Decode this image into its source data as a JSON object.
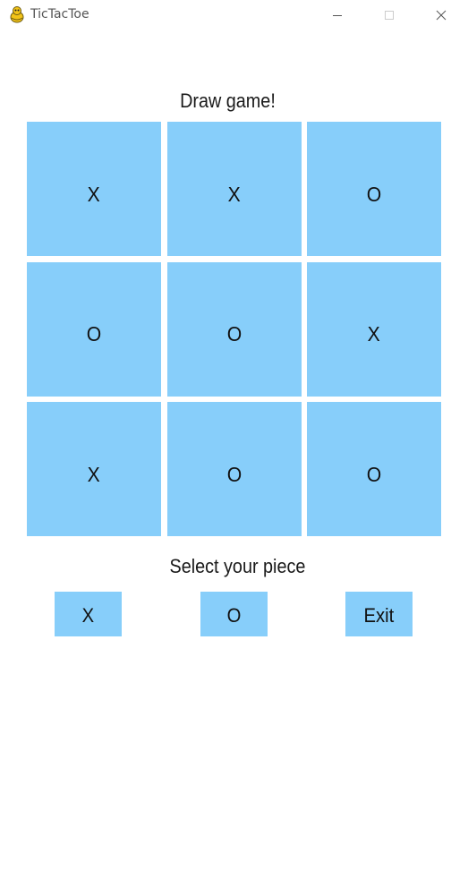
{
  "window": {
    "title": "TicTacToe",
    "icon": "pygame-snake-icon"
  },
  "game": {
    "status": "Draw game!",
    "board": [
      [
        "X",
        "X",
        "O"
      ],
      [
        "O",
        "O",
        "X"
      ],
      [
        "X",
        "O",
        "O"
      ]
    ]
  },
  "controls": {
    "select_label": "Select your piece",
    "piece_x_label": "X",
    "piece_o_label": "O",
    "exit_label": "Exit"
  },
  "colors": {
    "cell": "#87cefa",
    "background": "#ffffff"
  }
}
